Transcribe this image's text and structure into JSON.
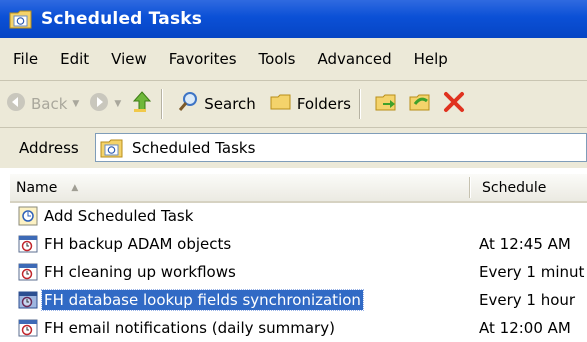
{
  "window": {
    "title": "Scheduled Tasks"
  },
  "menu": [
    "File",
    "Edit",
    "View",
    "Favorites",
    "Tools",
    "Advanced",
    "Help"
  ],
  "toolbar": {
    "back": "Back",
    "search": "Search",
    "folders": "Folders"
  },
  "address": {
    "label": "Address",
    "value": "Scheduled Tasks"
  },
  "columns": {
    "name": "Name",
    "schedule": "Schedule"
  },
  "rows": [
    {
      "name": "Add Scheduled Task",
      "schedule": "",
      "icon": "add-task-icon"
    },
    {
      "name": "FH backup ADAM objects",
      "schedule": "At 12:45 AM",
      "icon": "scheduled-task-icon"
    },
    {
      "name": "FH cleaning up workflows",
      "schedule": "Every 1 minut",
      "icon": "scheduled-task-icon"
    },
    {
      "name": "FH database lookup fields synchronization",
      "schedule": "Every 1 hour",
      "icon": "scheduled-task-icon",
      "selected": true
    },
    {
      "name": "FH email notifications (daily summary)",
      "schedule": "At 12:00 AM",
      "icon": "scheduled-task-icon"
    }
  ],
  "colors": {
    "title_bar": "#0b50d6",
    "selection": "#316ac5",
    "chrome": "#ece9d8"
  }
}
